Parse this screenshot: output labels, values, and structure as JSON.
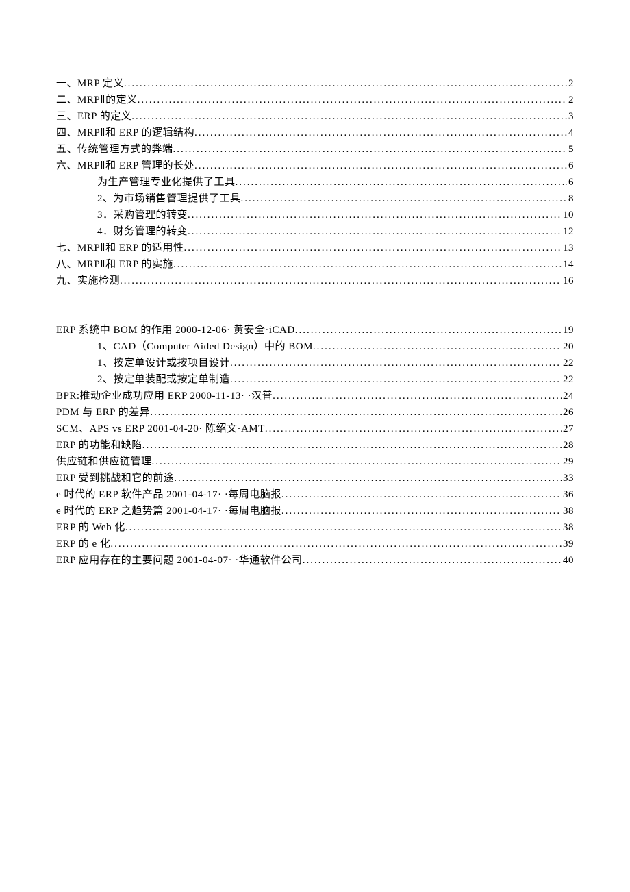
{
  "toc": [
    {
      "text": "一、MRP 定义",
      "page": "2",
      "indent": false
    },
    {
      "text": "二、MRPⅡ的定义",
      "page": "2",
      "indent": false
    },
    {
      "text": "三、ERP 的定义",
      "page": "3",
      "indent": false
    },
    {
      "text": "四、MRPⅡ和 ERP 的逻辑结构",
      "page": "4",
      "indent": false
    },
    {
      "text": "五、传统管理方式的弊端",
      "page": "5",
      "indent": false
    },
    {
      "text": "六、MRPⅡ和 ERP 管理的长处",
      "page": "6",
      "indent": false
    },
    {
      "text": "为生产管理专业化提供了工具",
      "page": "6",
      "indent": true
    },
    {
      "text": "2、为市场销售管理提供了工具",
      "page": "8",
      "indent": true
    },
    {
      "text": "3．采购管理的转变",
      "page": "10",
      "indent": true
    },
    {
      "text": "4．财务管理的转变",
      "page": "12",
      "indent": true
    },
    {
      "text": "七、MRPⅡ和 ERP 的适用性",
      "page": "13",
      "indent": false
    },
    {
      "text": "八、MRPⅡ和 ERP 的实施",
      "page": "14",
      "indent": false
    },
    {
      "text": "九、实施检测",
      "page": "16",
      "indent": false
    },
    {
      "spacer": true
    },
    {
      "text": "ERP 系统中 BOM 的作用  2000-12-06·  黄安全·iCAD",
      "page": "19",
      "indent": false
    },
    {
      "text": "1、CAD（Computer Aided Design）中的 BOM",
      "page": "20",
      "indent": true
    },
    {
      "text": "1、按定单设计或按项目设计",
      "page": "22",
      "indent": true
    },
    {
      "text": "2、按定单装配或按定单制造",
      "page": "22",
      "indent": true
    },
    {
      "text": "BPR:推动企业成功应用 ERP 2000-11-13·  ·汉普",
      "page": "24",
      "indent": false
    },
    {
      "text": "PDM 与 ERP 的差异",
      "page": "26",
      "indent": false
    },
    {
      "text": "SCM、APS vs ERP 2001-04-20·  陈绍文·AMT",
      "page": "27",
      "indent": false
    },
    {
      "text": "ERP 的功能和缺陷",
      "page": "28",
      "indent": false
    },
    {
      "text": "供应链和供应链管理",
      "page": "29",
      "indent": false
    },
    {
      "text": "ERP 受到挑战和它的前途",
      "page": "33",
      "indent": false
    },
    {
      "text": "e 时代的 ERP 软件产品 2001-04-17·  ·每周电脑报",
      "page": "36",
      "indent": false
    },
    {
      "text": "e 时代的 ERP 之趋势篇 2001-04-17·  ·每周电脑报",
      "page": "38",
      "indent": false
    },
    {
      "text": "ERP 的 Web 化",
      "page": "38",
      "indent": false
    },
    {
      "text": "ERP 的 e 化",
      "page": "39",
      "indent": false
    },
    {
      "text": "ERP 应用存在的主要问题 2001-04-07·  ·华通软件公司",
      "page": "40",
      "indent": false
    }
  ]
}
